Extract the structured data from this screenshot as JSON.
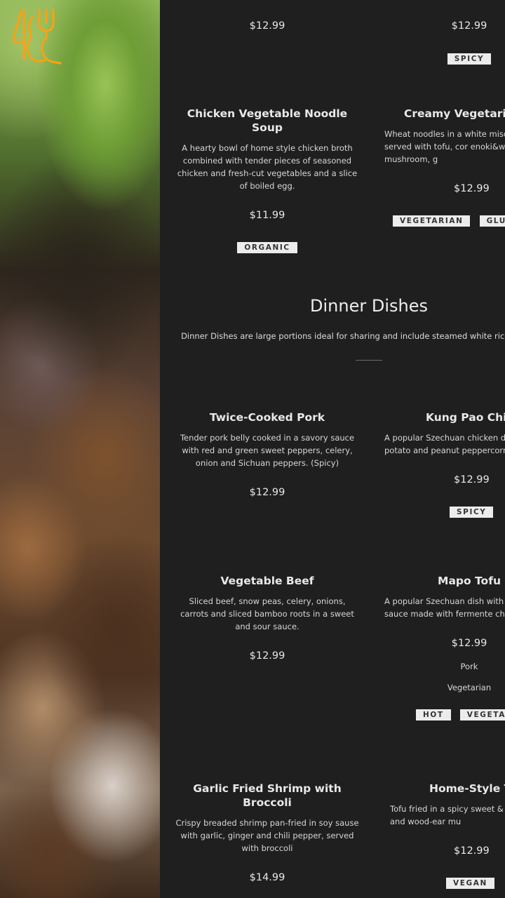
{
  "logo": {
    "icon": "fork-and-knife-logo",
    "color": "#f2a31d"
  },
  "top_items": {
    "left_price": "$12.99",
    "right_price": "$12.99",
    "right_tags": [
      "SPICY"
    ]
  },
  "items_row1": [
    {
      "title": "Chicken Vegetable Noodle Soup",
      "desc": "A hearty bowl of home style chicken broth combined with tender pieces of seasoned chicken and fresh-cut vegetables and a slice of boiled egg.",
      "price": "$11.99",
      "tags": [
        "ORGANIC"
      ]
    },
    {
      "title": "Creamy Vegetarian R",
      "desc": "Wheat noodles in a white miso cu dashi broth. served with tofu, cor enoki&wood ear mushroom, g",
      "price": "$12.99",
      "tags": [
        "VEGETARIAN",
        "GLUTE"
      ]
    }
  ],
  "section": {
    "title": "Dinner Dishes",
    "desc": "Dinner Dishes are large portions ideal for sharing and include steamed white rice and ar day."
  },
  "items_row2": [
    {
      "title": "Twice-Cooked Pork",
      "desc": "Tender pork belly cooked in a savory sauce with red and green sweet peppers, celery, onion and Sichuan peppers. (Spicy)",
      "price": "$12.99",
      "tags": []
    },
    {
      "title": "Kung Pao Chicke",
      "desc": "A popular Szechuan chicken dis celery, carrots, potato and peanut peppercorn sauce. (M",
      "price": "$12.99",
      "tags": [
        "SPICY"
      ]
    }
  ],
  "items_row3": [
    {
      "title": "Vegetable Beef",
      "desc": "Sliced beef, snow peas, celery, onions, carrots and sliced bamboo roots in a sweet and sour sauce.",
      "price": "$12.99",
      "tags": []
    },
    {
      "title": "Mapo Tofu",
      "desc": "A popular Szechuan dish with a m spicy sauce made with fermente chili paste.",
      "price": "$12.99",
      "options": [
        "Pork",
        "Vegetarian"
      ],
      "tags": [
        "HOT",
        "VEGETARI"
      ]
    }
  ],
  "items_row4": [
    {
      "title": "Garlic Fried Shrimp with Broccoli",
      "desc": "Crispy breaded shrimp pan-fried in soy sause with garlic, ginger and chili pepper, served with broccoli",
      "price": "$14.99",
      "tags": []
    },
    {
      "title": "Home-Style Tofu",
      "desc": "Tofu fried in a spicy sweet & sou baby choy and wood-ear mu",
      "price": "$12.99",
      "tags": [
        "VEGAN"
      ]
    }
  ]
}
